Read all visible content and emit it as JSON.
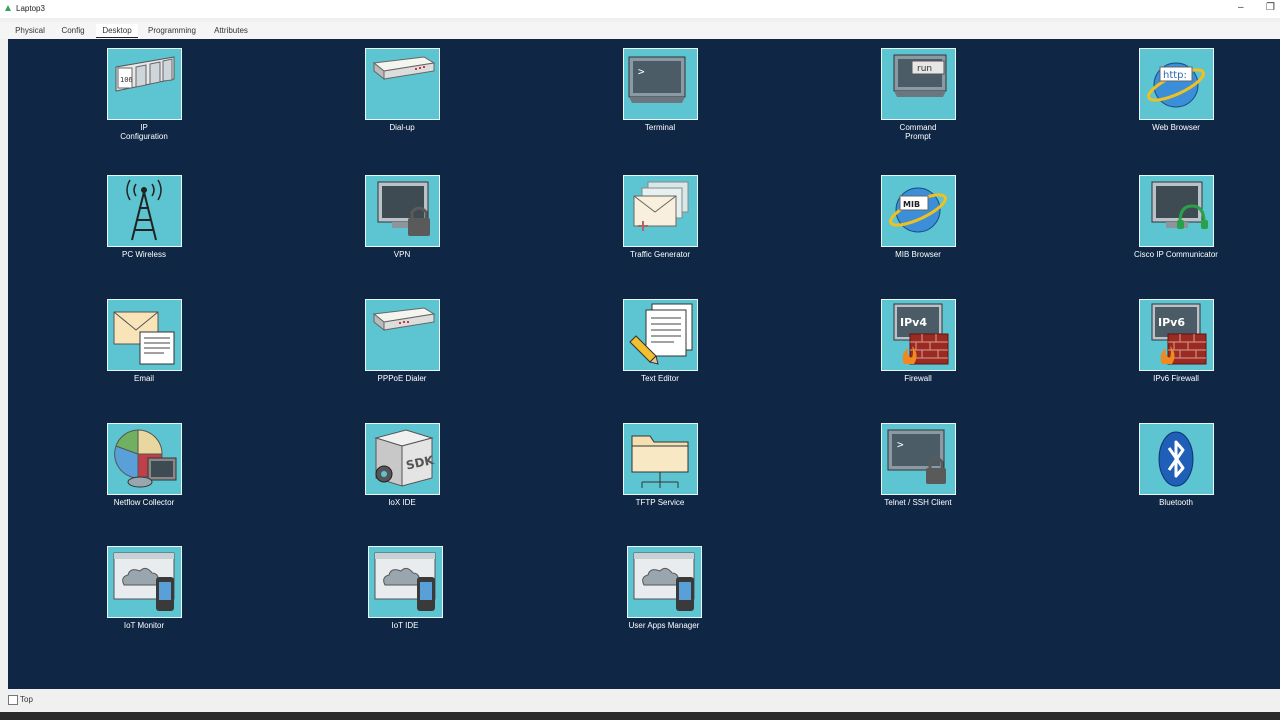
{
  "window": {
    "title": "Laptop3",
    "minimize_glyph": "–",
    "maximize_glyph": "❐"
  },
  "tabs": [
    {
      "label": "Physical"
    },
    {
      "label": "Config"
    },
    {
      "label": "Desktop"
    },
    {
      "label": "Programming"
    },
    {
      "label": "Attributes"
    }
  ],
  "active_tab": "Desktop",
  "apps": [
    {
      "label": "IP\nConfiguration",
      "icon": "ip-configuration-icon"
    },
    {
      "label": "Dial-up",
      "icon": "dialup-modem-icon"
    },
    {
      "label": "Terminal",
      "icon": "terminal-icon"
    },
    {
      "label": "Command\nPrompt",
      "icon": "command-prompt-icon",
      "icon_text": "run"
    },
    {
      "label": "Web Browser",
      "icon": "web-browser-icon",
      "icon_text": "http:"
    },
    {
      "label": "PC Wireless",
      "icon": "wireless-tower-icon"
    },
    {
      "label": "VPN",
      "icon": "vpn-monitor-lock-icon"
    },
    {
      "label": "Traffic Generator",
      "icon": "traffic-generator-icon"
    },
    {
      "label": "MIB Browser",
      "icon": "mib-browser-icon",
      "icon_text": "MIB"
    },
    {
      "label": "Cisco IP Communicator",
      "icon": "ip-communicator-headset-icon"
    },
    {
      "label": "Email",
      "icon": "email-icon"
    },
    {
      "label": "PPPoE Dialer",
      "icon": "pppoe-dialer-icon"
    },
    {
      "label": "Text Editor",
      "icon": "text-editor-icon"
    },
    {
      "label": "Firewall",
      "icon": "ipv4-firewall-icon",
      "icon_text": "IPv4"
    },
    {
      "label": "IPv6 Firewall",
      "icon": "ipv6-firewall-icon",
      "icon_text": "IPv6"
    },
    {
      "label": "Netflow Collector",
      "icon": "netflow-collector-icon"
    },
    {
      "label": "IoX IDE",
      "icon": "iox-sdk-icon",
      "icon_text": "SDK"
    },
    {
      "label": "TFTP Service",
      "icon": "tftp-folder-icon"
    },
    {
      "label": "Telnet / SSH Client",
      "icon": "telnet-ssh-icon"
    },
    {
      "label": "Bluetooth",
      "icon": "bluetooth-icon"
    },
    {
      "label": "IoT Monitor",
      "icon": "iot-monitor-cloud-icon"
    },
    {
      "label": "IoT IDE",
      "icon": "iot-ide-cloud-icon"
    },
    {
      "label": "User Apps Manager",
      "icon": "user-apps-manager-icon"
    }
  ],
  "statusbar": {
    "top_label": "Top",
    "top_checked": false
  },
  "colors": {
    "desktop_bg": "#0f2744",
    "tile_bg": "#5dc4d1"
  }
}
